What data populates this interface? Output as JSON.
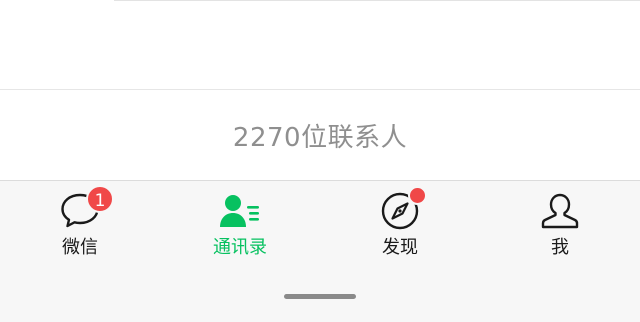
{
  "contacts": {
    "count_text": "2270位联系人"
  },
  "tabbar": {
    "active_color": "#07c160",
    "badge_color": "#f04848",
    "tabs": [
      {
        "label": "微信",
        "icon": "chat-bubble-icon",
        "badge": "1",
        "active": false
      },
      {
        "label": "通讯录",
        "icon": "contacts-icon",
        "active": true
      },
      {
        "label": "发现",
        "icon": "compass-icon",
        "badge_dot": true,
        "active": false
      },
      {
        "label": "我",
        "icon": "person-icon",
        "active": false
      }
    ]
  }
}
